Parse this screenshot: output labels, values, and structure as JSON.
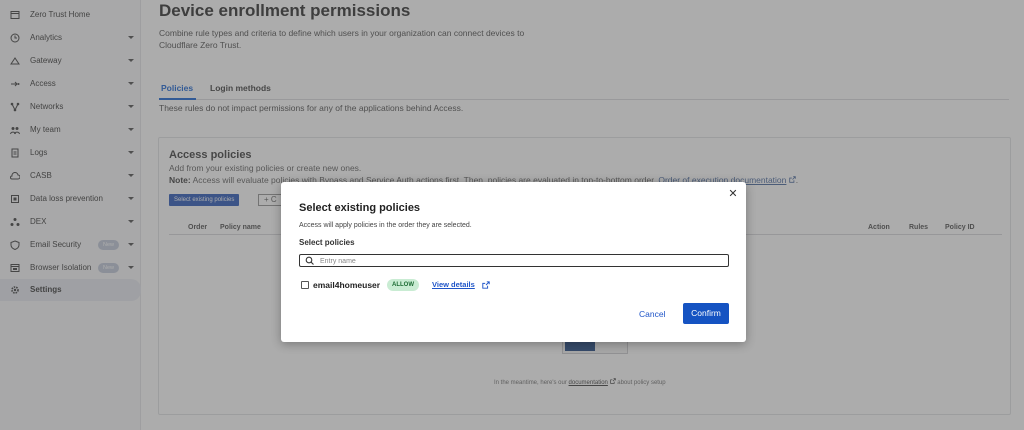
{
  "sidebar": {
    "items": [
      {
        "label": "Zero Trust Home",
        "icon": "calendar-icon",
        "chevron": false
      },
      {
        "label": "Analytics",
        "icon": "clock-icon",
        "chevron": true
      },
      {
        "label": "Gateway",
        "icon": "gateway-icon",
        "chevron": true
      },
      {
        "label": "Access",
        "icon": "access-icon",
        "chevron": true
      },
      {
        "label": "Networks",
        "icon": "network-icon",
        "chevron": true
      },
      {
        "label": "My team",
        "icon": "team-icon",
        "chevron": true
      },
      {
        "label": "Logs",
        "icon": "logs-icon",
        "chevron": true
      },
      {
        "label": "CASB",
        "icon": "casb-icon",
        "chevron": true
      },
      {
        "label": "Data loss prevention",
        "icon": "dlp-icon",
        "chevron": true
      },
      {
        "label": "DEX",
        "icon": "dex-icon",
        "chevron": true
      },
      {
        "label": "Email Security",
        "icon": "email-security-icon",
        "chevron": true,
        "badge": "New"
      },
      {
        "label": "Browser Isolation",
        "icon": "browser-isolation-icon",
        "chevron": true,
        "badge": "New"
      },
      {
        "label": "Settings",
        "icon": "gear-icon",
        "chevron": false,
        "active": true
      }
    ]
  },
  "page": {
    "title": "Device enrollment permissions",
    "description": "Combine rule types and criteria to define which users in your organization can connect devices to Cloudflare Zero Trust.",
    "tabs": [
      {
        "label": "Policies",
        "active": true
      },
      {
        "label": "Login methods",
        "active": false
      }
    ],
    "tab_note": "These rules do not impact permissions for any of the applications behind Access."
  },
  "card": {
    "title": "Access policies",
    "subtitle": "Add from your existing policies or create new ones.",
    "note_bold": "Note:",
    "note_text": " Access will evaluate policies with Bypass and Service Auth actions first. Then, policies are evaluated in top-to-bottom order.",
    "note_link": "Order of execution documentation",
    "select_button": "Select existing policies",
    "create_button": "+ C",
    "columns": [
      "Order",
      "Policy name",
      "Action",
      "Rules",
      "Policy ID"
    ],
    "empty_prefix": "In the meantime, here's our",
    "empty_link": "documentation",
    "empty_suffix": "about policy setup"
  },
  "modal": {
    "title": "Select existing policies",
    "description": "Access will apply policies in the order they are selected.",
    "label": "Select policies",
    "search_placeholder": "Entry name",
    "policies": [
      {
        "name": "email4homeuser",
        "action": "ALLOW",
        "link": "View details",
        "checked": false
      }
    ],
    "cancel": "Cancel",
    "confirm": "Confirm"
  },
  "colors": {
    "accent": "#1553c2",
    "allow_bg": "#c9ecd3",
    "allow_text": "#1c6b33"
  }
}
